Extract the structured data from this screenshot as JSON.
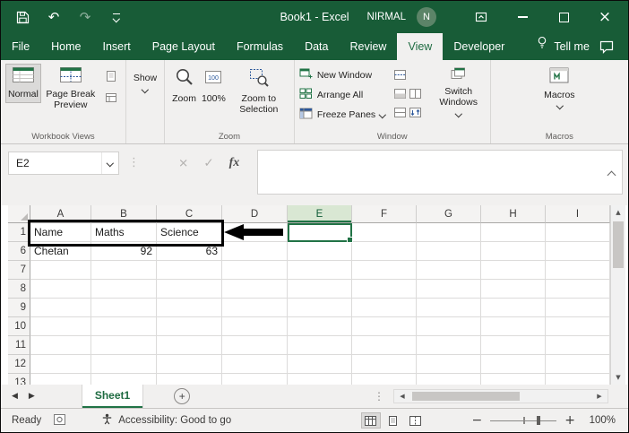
{
  "colors": {
    "accent": "#217346",
    "titlebar_green": "#185c37",
    "selection_green": "#217346",
    "annotation_black": "#000000"
  },
  "titlebar": {
    "title": "Book1 - Excel",
    "user": "NIRMAL",
    "avatar_initial": "N"
  },
  "icons": {
    "undo": "↶",
    "redo": "↷",
    "dots": "⋮",
    "left": "◀",
    "right": "▶",
    "up": "▲",
    "down": "▼",
    "cancel": "×",
    "check": "✓",
    "add": "+",
    "minus": "−",
    "plus": "+"
  },
  "tabs": {
    "items": [
      "File",
      "Home",
      "Insert",
      "Page Layout",
      "Formulas",
      "Data",
      "Review",
      "View",
      "Developer"
    ],
    "selected": "View",
    "tell_me": "Tell me"
  },
  "ribbon": {
    "workbook_views": {
      "group_label": "Workbook Views",
      "normal": "Normal",
      "page_break_preview": "Page Break Preview"
    },
    "show": {
      "button": "Show"
    },
    "zoom": {
      "group_label": "Zoom",
      "zoom": "Zoom",
      "hundred": "100%",
      "zoom_to_selection": "Zoom to Selection"
    },
    "window": {
      "group_label": "Window",
      "new_window": "New Window",
      "arrange_all": "Arrange All",
      "freeze_panes": "Freeze Panes",
      "switch_windows": "Switch Windows"
    },
    "macros": {
      "group_label": "Macros",
      "button": "Macros"
    }
  },
  "formula_bar": {
    "name_box": "E2",
    "fx": "fx",
    "formula_value": ""
  },
  "grid": {
    "columns": [
      "A",
      "B",
      "C",
      "D",
      "E",
      "F",
      "G",
      "H",
      "I"
    ],
    "selected_column": "E",
    "rows": [
      "1",
      "6",
      "7",
      "8",
      "9",
      "10",
      "11",
      "12",
      "13"
    ],
    "cells": {
      "r1": {
        "A": "Name",
        "B": "Maths",
        "C": "Science"
      },
      "r6": {
        "A": "Chetan",
        "B": "92",
        "C": "63"
      }
    }
  },
  "sheet_bar": {
    "active_tab": "Sheet1"
  },
  "status_bar": {
    "mode": "Ready",
    "accessibility": "Accessibility: Good to go",
    "zoom_level": "100%"
  }
}
